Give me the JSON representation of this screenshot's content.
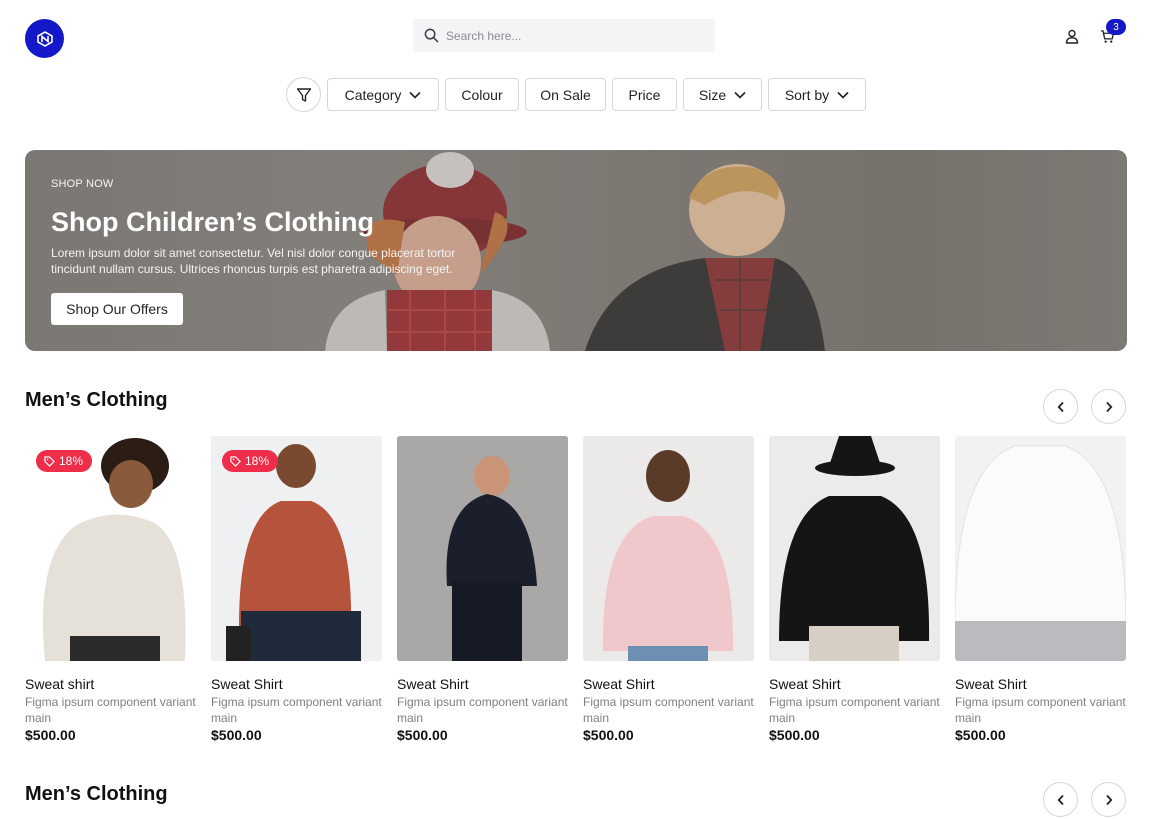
{
  "header": {
    "search_placeholder": "Search here...",
    "cart_count": "3"
  },
  "filters": {
    "chips": [
      "Category",
      "Colour",
      "On Sale",
      "Price",
      "Size",
      "Sort by"
    ]
  },
  "banner": {
    "kicker": "SHOP NOW",
    "title": "Shop Children’s Clothing",
    "description": "Lorem ipsum dolor sit amet consectetur. Vel nisl dolor congue placerat tortor tincidunt nullam cursus. Ultrices rhoncus turpis est pharetra adipiscing eget.",
    "button_label": "Shop Our Offers"
  },
  "sections": [
    {
      "title": "Men’s Clothing",
      "products": [
        {
          "name": "Sweat shirt",
          "desc": "Figma ipsum component variant main",
          "price": "$500.00",
          "discount": "18%",
          "color": "#e8e3da"
        },
        {
          "name": "Sweat Shirt",
          "desc": "Figma ipsum component variant main",
          "price": "$500.00",
          "discount": "18%",
          "color": "#b5533c"
        },
        {
          "name": "Sweat Shirt",
          "desc": "Figma ipsum component variant main",
          "price": "$500.00",
          "discount": "",
          "color": "#1b1f2b"
        },
        {
          "name": "Sweat Shirt",
          "desc": "Figma ipsum component variant main",
          "price": "$500.00",
          "discount": "",
          "color": "#f0c8cc"
        },
        {
          "name": "Sweat Shirt",
          "desc": "Figma ipsum component variant main",
          "price": "$500.00",
          "discount": "",
          "color": "#151515"
        },
        {
          "name": "Sweat Shirt",
          "desc": "Figma ipsum component variant main",
          "price": "$500.00",
          "discount": "",
          "color": "#f7f7f7"
        }
      ]
    },
    {
      "title": "Men’s Clothing"
    }
  ],
  "colors": {
    "brand": "#1418c9",
    "discount": "#ee2d4a"
  }
}
